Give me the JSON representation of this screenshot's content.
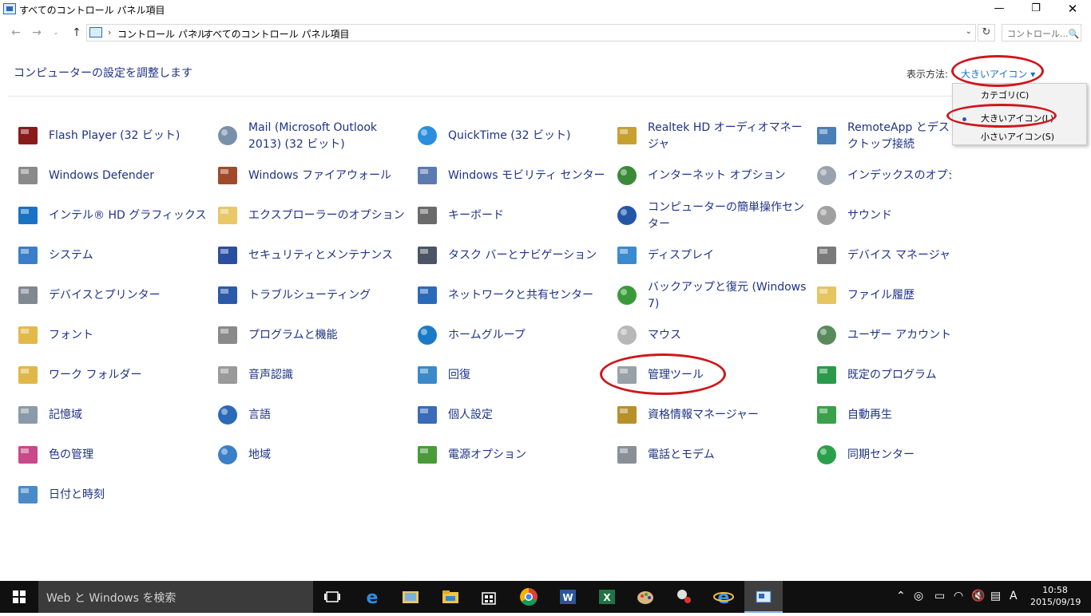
{
  "window": {
    "title": "すべてのコントロール パネル項目",
    "min_glyph": "—",
    "max_glyph": "❐",
    "close_glyph": "✕"
  },
  "address": {
    "crumb1": "コントロール パネル",
    "crumb2": "すべてのコントロール パネル項目",
    "search_placeholder": "コントロール...🔍"
  },
  "header": {
    "title": "コンピューターの設定を調整します",
    "viewby_label": "表示方法:",
    "viewby_value": "大きいアイコン ▾"
  },
  "view_menu": {
    "options": [
      "カテゴリ(C)",
      "大きいアイコン(L)",
      "小さいアイコン(S)"
    ],
    "selected": "大きいアイコン(L)"
  },
  "items": [
    {
      "label": "Flash Player (32 ビット)",
      "icon": "flash-icon"
    },
    {
      "label": "Mail (Microsoft Outlook 2013) (32 ビット)",
      "icon": "mail-icon"
    },
    {
      "label": "QuickTime (32 ビット)",
      "icon": "quicktime-icon"
    },
    {
      "label": "Realtek HD オーディオマネージャ",
      "icon": "realtek-icon"
    },
    {
      "label": "RemoteApp とデスクトップ接続",
      "icon": "remoteapp-icon"
    },
    {
      "label": "Windows Defender",
      "icon": "defender-icon"
    },
    {
      "label": "Windows ファイアウォール",
      "icon": "firewall-icon"
    },
    {
      "label": "Windows モビリティ センター",
      "icon": "mobility-icon"
    },
    {
      "label": "インターネット オプション",
      "icon": "internet-options-icon"
    },
    {
      "label": "インデックスのオプション",
      "icon": "indexing-icon"
    },
    {
      "label": "インテル® HD グラフィックス",
      "icon": "intel-graphics-icon"
    },
    {
      "label": "エクスプローラーのオプション",
      "icon": "explorer-options-icon"
    },
    {
      "label": "キーボード",
      "icon": "keyboard-icon"
    },
    {
      "label": "コンピューターの簡単操作センター",
      "icon": "ease-of-access-icon"
    },
    {
      "label": "サウンド",
      "icon": "sound-icon"
    },
    {
      "label": "システム",
      "icon": "system-icon"
    },
    {
      "label": "セキュリティとメンテナンス",
      "icon": "security-flag-icon"
    },
    {
      "label": "タスク バーとナビゲーション",
      "icon": "taskbar-icon"
    },
    {
      "label": "ディスプレイ",
      "icon": "display-icon"
    },
    {
      "label": "デバイス マネージャー",
      "icon": "device-manager-icon"
    },
    {
      "label": "デバイスとプリンター",
      "icon": "printer-icon"
    },
    {
      "label": "トラブルシューティング",
      "icon": "troubleshoot-icon"
    },
    {
      "label": "ネットワークと共有センター",
      "icon": "network-icon"
    },
    {
      "label": "バックアップと復元 (Windows 7)",
      "icon": "backup-icon"
    },
    {
      "label": "ファイル履歴",
      "icon": "file-history-icon"
    },
    {
      "label": "フォント",
      "icon": "font-icon"
    },
    {
      "label": "プログラムと機能",
      "icon": "programs-icon"
    },
    {
      "label": "ホームグループ",
      "icon": "homegroup-icon"
    },
    {
      "label": "マウス",
      "icon": "mouse-icon"
    },
    {
      "label": "ユーザー アカウント",
      "icon": "user-accounts-icon"
    },
    {
      "label": "ワーク フォルダー",
      "icon": "work-folders-icon"
    },
    {
      "label": "音声認識",
      "icon": "microphone-icon"
    },
    {
      "label": "回復",
      "icon": "recovery-icon"
    },
    {
      "label": "管理ツール",
      "icon": "admin-tools-icon"
    },
    {
      "label": "既定のプログラム",
      "icon": "default-programs-icon"
    },
    {
      "label": "記憶域",
      "icon": "storage-icon"
    },
    {
      "label": "言語",
      "icon": "language-icon"
    },
    {
      "label": "個人設定",
      "icon": "personalize-icon"
    },
    {
      "label": "資格情報マネージャー",
      "icon": "credential-icon"
    },
    {
      "label": "自動再生",
      "icon": "autoplay-icon"
    },
    {
      "label": "色の管理",
      "icon": "color-icon"
    },
    {
      "label": "地域",
      "icon": "region-icon"
    },
    {
      "label": "電源オプション",
      "icon": "power-icon"
    },
    {
      "label": "電話とモデム",
      "icon": "phone-modem-icon"
    },
    {
      "label": "同期センター",
      "icon": "sync-icon"
    },
    {
      "label": "日付と時刻",
      "icon": "calendar-icon"
    }
  ],
  "taskbar": {
    "search_placeholder": "Web と Windows を検索",
    "ime": "A",
    "time": "10:58",
    "date": "2015/09/19"
  }
}
